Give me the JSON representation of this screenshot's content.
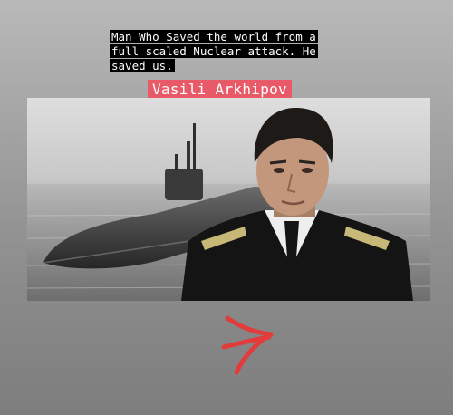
{
  "caption": {
    "lines": [
      "Man Who Saved the world from a",
      "full scaled Nuclear attack. He",
      "saved us."
    ]
  },
  "name_tag": "Vasili Arkhipov",
  "photo": {
    "subject": "portrait-with-submarine"
  },
  "arrow": {
    "icon": "arrow-right-icon",
    "color": "#e23b3b"
  }
}
